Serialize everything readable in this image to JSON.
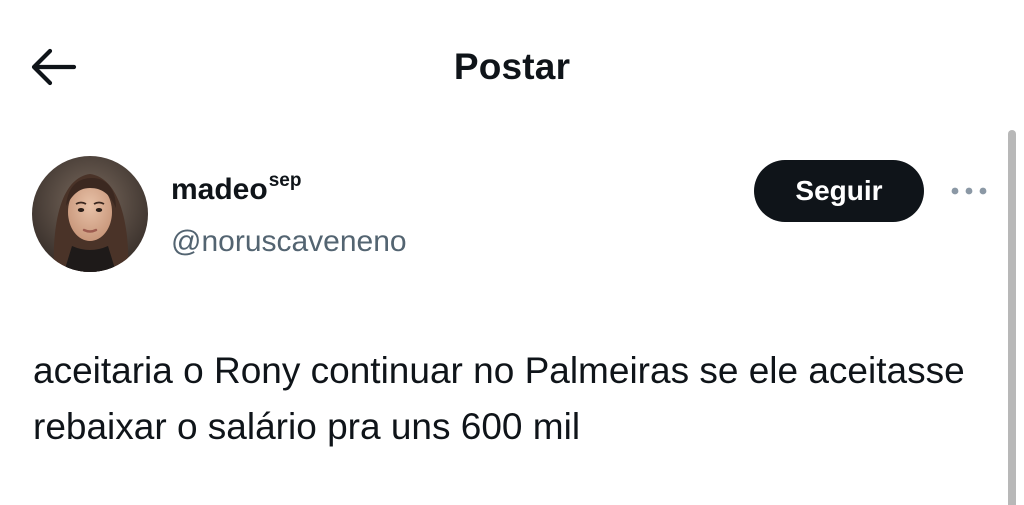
{
  "header": {
    "title": "Postar",
    "back_icon": "arrow-left-icon"
  },
  "author": {
    "display_name": "madeo",
    "display_name_superscript": "sep",
    "handle": "@noruscaveneno",
    "avatar_icon": "profile-photo"
  },
  "actions": {
    "follow_label": "Seguir",
    "more_icon": "more-horizontal-icon"
  },
  "post": {
    "text": "aceitaria o Rony continuar no Palmeiras se ele aceitasse rebaixar o salário pra uns 600 mil"
  },
  "colors": {
    "text_primary": "#0f1419",
    "text_secondary": "#536471",
    "button_bg": "#0f1419",
    "button_text": "#ffffff",
    "background": "#ffffff"
  }
}
